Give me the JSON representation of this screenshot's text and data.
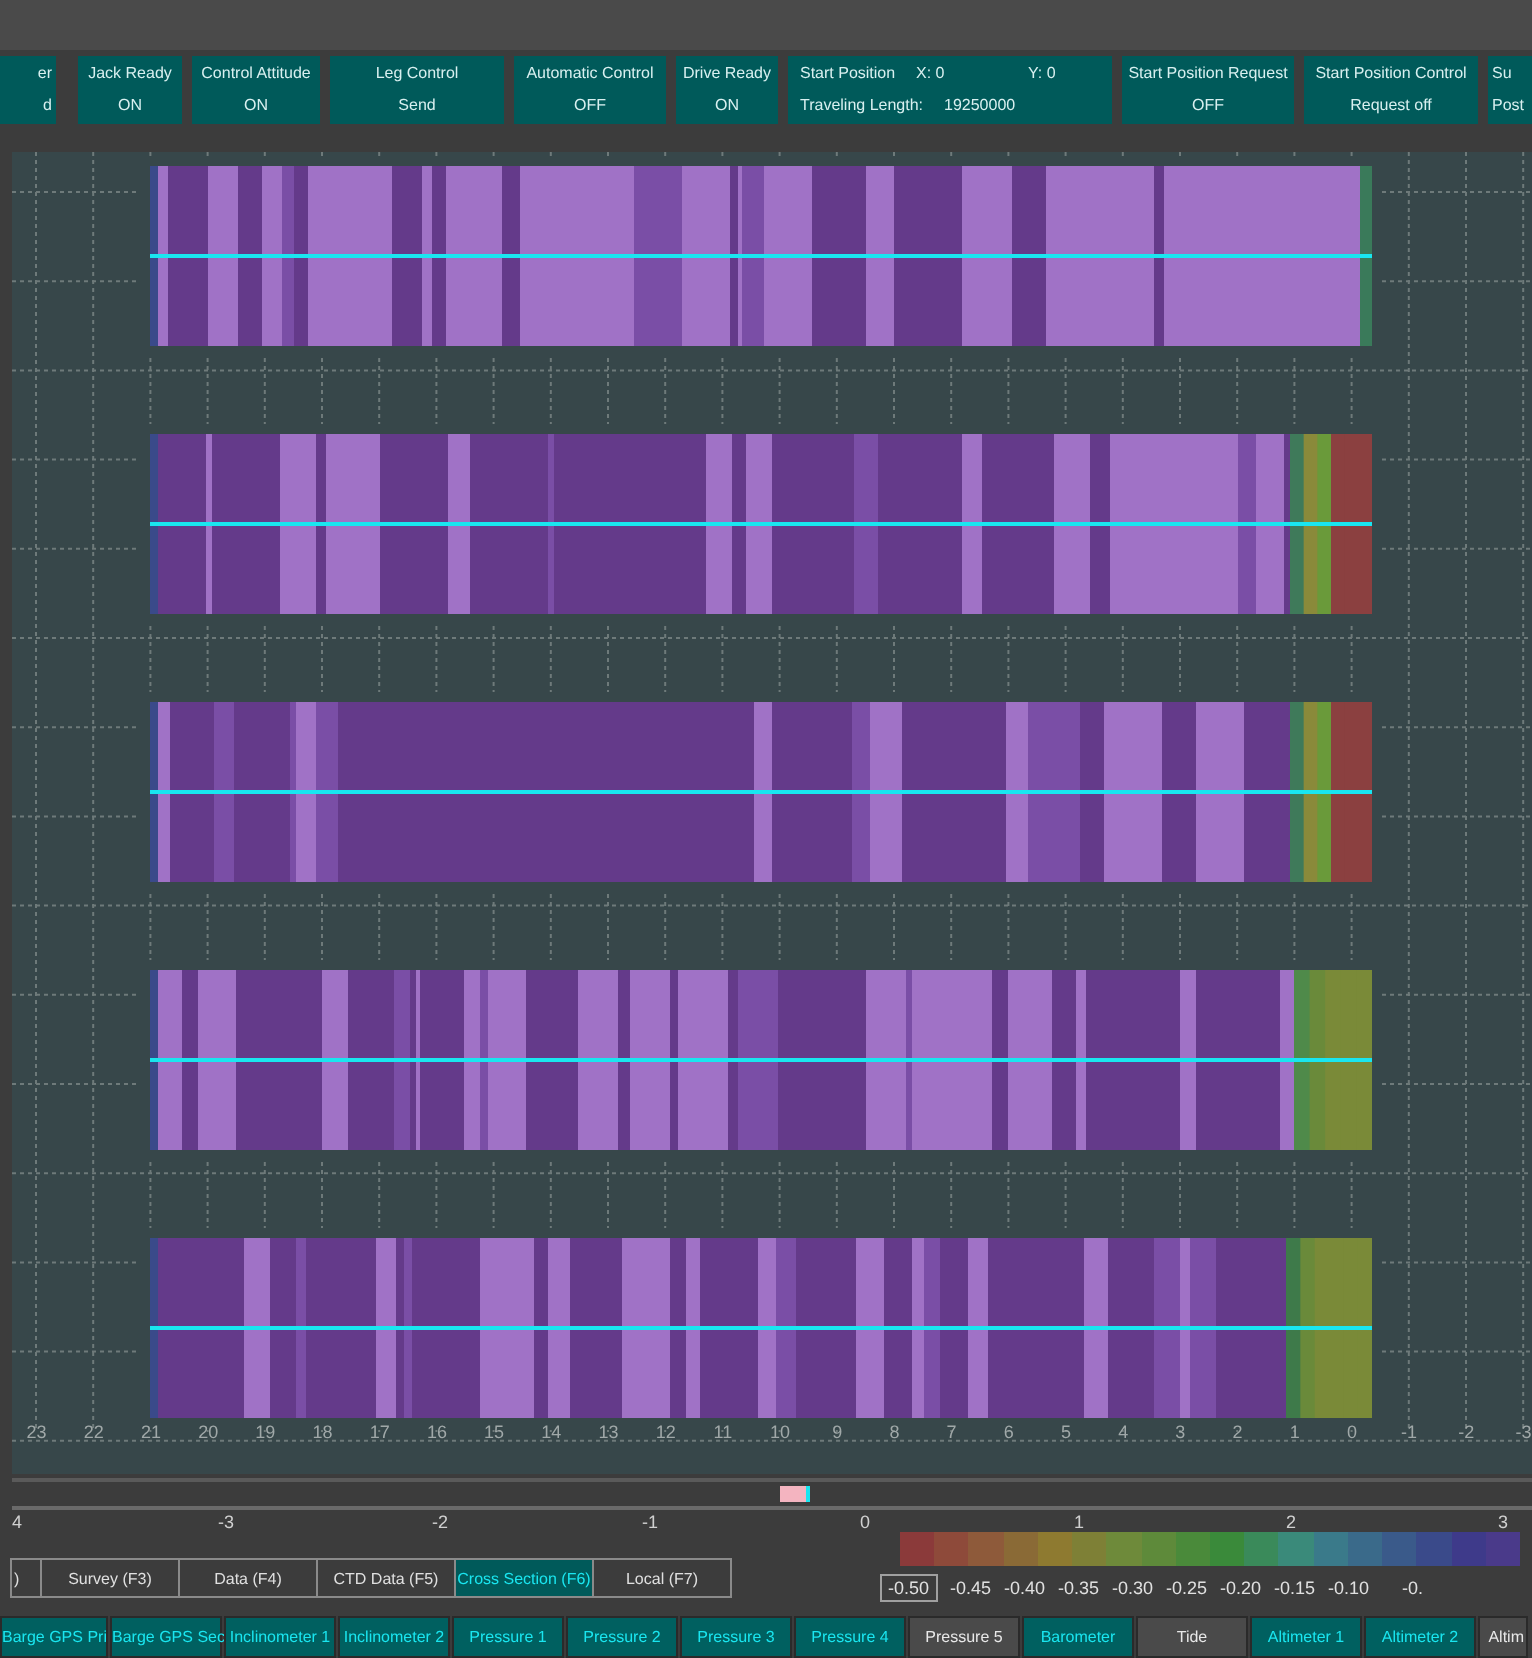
{
  "status_panels": [
    {
      "kind": "status",
      "label": "er",
      "value": "d"
    },
    {
      "kind": "status",
      "label": "Jack Ready",
      "value": "ON"
    },
    {
      "kind": "status",
      "label": "Control Attitude",
      "value": "ON"
    },
    {
      "kind": "status",
      "label": "Leg Control",
      "value": "Send"
    },
    {
      "kind": "status",
      "label": "Automatic Control",
      "value": "OFF"
    },
    {
      "kind": "status",
      "label": "Drive Ready",
      "value": "ON"
    },
    {
      "kind": "position",
      "label": "Start Position",
      "x": "X: 0",
      "y": "Y: 0",
      "length_label": "Traveling Length:",
      "length": "19250000"
    },
    {
      "kind": "status",
      "label": "Start Position Request",
      "value": "OFF"
    },
    {
      "kind": "status",
      "label": "Start Position Control",
      "value": "Request off"
    },
    {
      "kind": "status",
      "label": "Su",
      "value": "Post"
    }
  ],
  "cross_section": {
    "bands": [
      {
        "kind": "light"
      },
      {
        "kind": "red-end"
      },
      {
        "kind": "red-end"
      },
      {
        "kind": "green-end"
      },
      {
        "kind": "olive-end"
      }
    ],
    "x_axis_labels": [
      "23",
      "22",
      "21",
      "20",
      "19",
      "18",
      "17",
      "16",
      "15",
      "14",
      "13",
      "12",
      "11",
      "10",
      "9",
      "8",
      "7",
      "6",
      "5",
      "4",
      "3",
      "2",
      "1",
      "0",
      "-1",
      "-2",
      "-3"
    ]
  },
  "lower_axis_labels": [
    "4",
    "-3",
    "-2",
    "-1",
    "0",
    "1",
    "2",
    "3"
  ],
  "tabs": [
    {
      "label": ")",
      "selected": false
    },
    {
      "label": "Survey (F3)",
      "selected": false
    },
    {
      "label": "Data (F4)",
      "selected": false
    },
    {
      "label": "CTD Data (F5)",
      "selected": false
    },
    {
      "label": "Cross Section (F6)",
      "selected": true
    },
    {
      "label": "Local (F7)",
      "selected": false
    }
  ],
  "color_scale": {
    "min_value": "-0.50",
    "labels": [
      "-0.45",
      "-0.40",
      "-0.35",
      "-0.30",
      "-0.25",
      "-0.20",
      "-0.15",
      "-0.10",
      "-0."
    ]
  },
  "sensor_buttons": [
    {
      "label": "Barge GPS Pri",
      "active": true
    },
    {
      "label": "Barge GPS Sec",
      "active": true
    },
    {
      "label": "Inclinometer 1",
      "active": true
    },
    {
      "label": "Inclinometer 2",
      "active": true
    },
    {
      "label": "Pressure 1",
      "active": true
    },
    {
      "label": "Pressure 2",
      "active": true
    },
    {
      "label": "Pressure 3",
      "active": true
    },
    {
      "label": "Pressure 4",
      "active": true
    },
    {
      "label": "Pressure 5",
      "active": false
    },
    {
      "label": "Barometer",
      "active": true
    },
    {
      "label": "Tide",
      "active": false
    },
    {
      "label": "Altimeter 1",
      "active": true
    },
    {
      "label": "Altimeter 2",
      "active": true
    },
    {
      "label": "Altim",
      "active": false
    }
  ]
}
